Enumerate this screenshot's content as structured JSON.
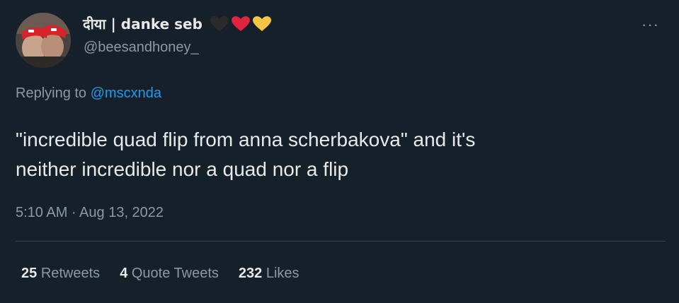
{
  "user": {
    "display_name": "दीया | danke seb",
    "emojis": [
      "black-heart",
      "red-heart",
      "yellow-heart"
    ],
    "handle": "@beesandhoney_"
  },
  "more_label": "···",
  "reply": {
    "prefix": "Replying to",
    "mention": "@mscxnda"
  },
  "tweet": {
    "text_line1": "\"incredible quad flip from anna scherbakova\" and it's",
    "text_line2": "neither incredible nor a quad nor a flip",
    "timestamp": "5:10 AM · Aug 13, 2022"
  },
  "stats": {
    "retweets_count": "25",
    "retweets_label": "Retweets",
    "quotes_count": "4",
    "quotes_label": "Quote Tweets",
    "likes_count": "232",
    "likes_label": "Likes"
  },
  "colors": {
    "background": "#15202b",
    "text_primary": "#e7e9ea",
    "text_secondary": "#8b98a5",
    "link": "#1d9bf0",
    "divider": "#38444d",
    "heart_black": "#2b2b2b",
    "heart_red": "#e0243f",
    "heart_yellow": "#f4c542"
  }
}
